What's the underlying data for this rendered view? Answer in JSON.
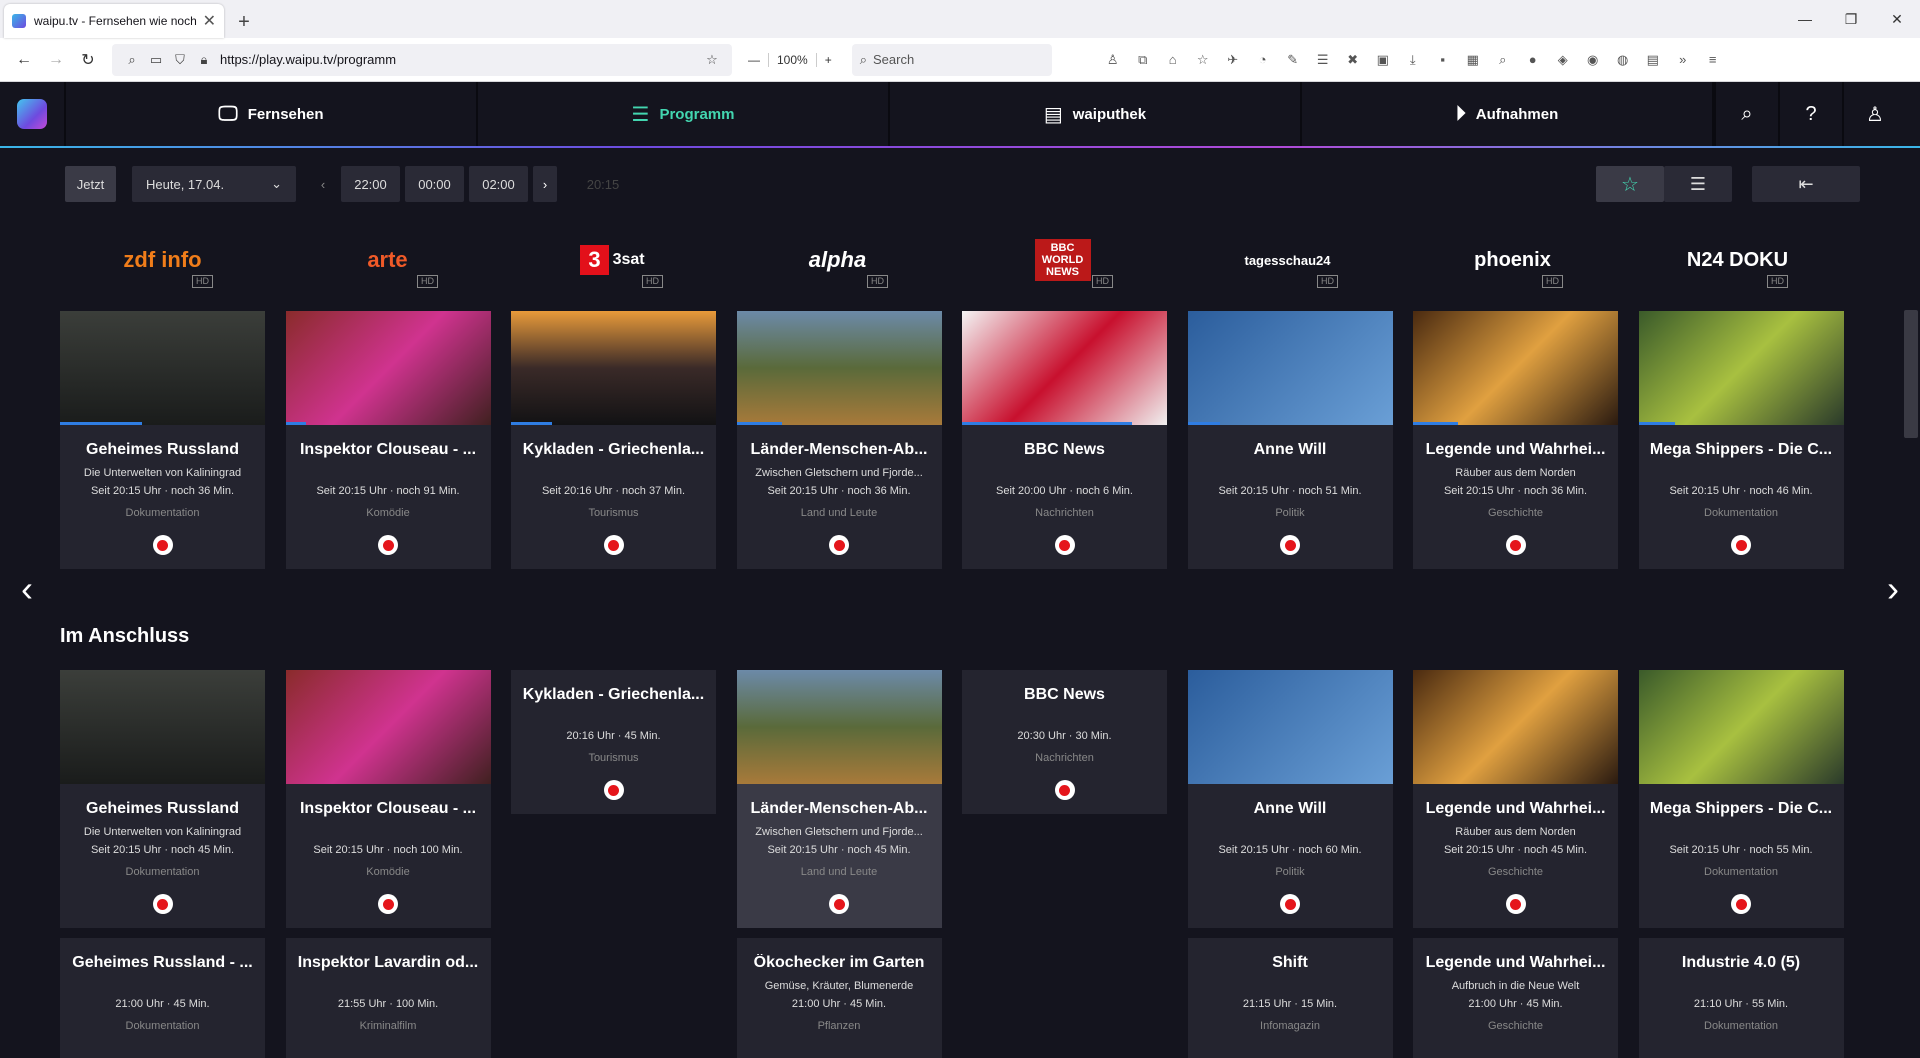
{
  "browser": {
    "tab_title": "waipu.tv - Fernsehen wie noch nie",
    "url": "https://play.waipu.tv/programm",
    "zoom": "100%",
    "search_placeholder": "Search"
  },
  "header": {
    "nav": [
      {
        "label": "Fernsehen",
        "icon": "tv-icon"
      },
      {
        "label": "Programm",
        "icon": "program-guide-icon",
        "active": true
      },
      {
        "label": "waiputhek",
        "icon": "library-icon"
      },
      {
        "label": "Aufnahmen",
        "icon": "play-circle-icon"
      }
    ]
  },
  "filters": {
    "now_label": "Jetzt",
    "date_label": "Heute, 17.04.",
    "times": [
      "22:00",
      "00:00",
      "02:00"
    ],
    "current_time": "20:15"
  },
  "channels": [
    {
      "name": "zdf info",
      "hd": "HD"
    },
    {
      "name": "arte",
      "hd": "HD"
    },
    {
      "name": "3sat",
      "hd": "HD"
    },
    {
      "name": "alpha",
      "hd": "HD"
    },
    {
      "name": "BBC WORLD NEWS",
      "hd": "HD"
    },
    {
      "name": "tagesschau24",
      "hd": "HD"
    },
    {
      "name": "phoenix",
      "hd": "HD"
    },
    {
      "name": "N24 DOKU",
      "hd": "HD"
    }
  ],
  "now_row": [
    {
      "title": "Geheimes Russland",
      "subtitle": "Die Unterwelten von Kaliningrad",
      "time": "Seit 20:15 Uhr · noch 36 Min.",
      "genre": "Dokumentation",
      "progress": 0.4
    },
    {
      "title": "Inspektor Clouseau - ...",
      "subtitle": "",
      "time": "Seit 20:15 Uhr · noch 91 Min.",
      "genre": "Komödie",
      "progress": 0.1
    },
    {
      "title": "Kykladen - Griechenla...",
      "subtitle": "",
      "time": "Seit 20:16 Uhr · noch 37 Min.",
      "genre": "Tourismus",
      "progress": 0.2
    },
    {
      "title": "Länder-Menschen-Ab...",
      "subtitle": "Zwischen Gletschern und Fjorde...",
      "time": "Seit 20:15 Uhr · noch 36 Min.",
      "genre": "Land und Leute",
      "progress": 0.22
    },
    {
      "title": "BBC News",
      "subtitle": "",
      "time": "Seit 20:00 Uhr · noch 6 Min.",
      "genre": "Nachrichten",
      "progress": 0.83
    },
    {
      "title": "Anne Will",
      "subtitle": "",
      "time": "Seit 20:15 Uhr · noch 51 Min.",
      "genre": "Politik",
      "progress": 0.16
    },
    {
      "title": "Legende und Wahrhei...",
      "subtitle": "Räuber aus dem Norden",
      "time": "Seit 20:15 Uhr · noch 36 Min.",
      "genre": "Geschichte",
      "progress": 0.22
    },
    {
      "title": "Mega Shippers - Die C...",
      "subtitle": "",
      "time": "Seit 20:15 Uhr · noch 46 Min.",
      "genre": "Dokumentation",
      "progress": 0.18
    }
  ],
  "next_section_title": "Im Anschluss",
  "next_row": [
    {
      "title": "Geheimes Russland",
      "subtitle": "Die Unterwelten von Kaliningrad",
      "time": "Seit 20:15 Uhr · noch 45 Min.",
      "genre": "Dokumentation",
      "thumb": true
    },
    {
      "title": "Inspektor Clouseau - ...",
      "subtitle": "",
      "time": "Seit 20:15 Uhr · noch 100 Min.",
      "genre": "Komödie",
      "thumb": true
    },
    {
      "title": "Kykladen - Griechenla...",
      "subtitle": "",
      "time": "20:16 Uhr · 45 Min.",
      "genre": "Tourismus",
      "thumb": false
    },
    {
      "title": "Länder-Menschen-Ab...",
      "subtitle": "Zwischen Gletschern und Fjorde...",
      "time": "Seit 20:15 Uhr · noch 45 Min.",
      "genre": "Land und Leute",
      "thumb": true,
      "highlight": true
    },
    {
      "title": "BBC News",
      "subtitle": "",
      "time": "20:30 Uhr · 30 Min.",
      "genre": "Nachrichten",
      "thumb": false
    },
    {
      "title": "Anne Will",
      "subtitle": "",
      "time": "Seit 20:15 Uhr · noch 60 Min.",
      "genre": "Politik",
      "thumb": true
    },
    {
      "title": "Legende und Wahrhei...",
      "subtitle": "Räuber aus dem Norden",
      "time": "Seit 20:15 Uhr · noch 45 Min.",
      "genre": "Geschichte",
      "thumb": true
    },
    {
      "title": "Mega Shippers - Die C...",
      "subtitle": "",
      "time": "Seit 20:15 Uhr · noch 55 Min.",
      "genre": "Dokumentation",
      "thumb": true
    }
  ],
  "later_row": [
    {
      "title": "Geheimes Russland - ...",
      "subtitle": "",
      "time": "21:00 Uhr · 45 Min.",
      "genre": "Dokumentation"
    },
    {
      "title": "Inspektor Lavardin od...",
      "subtitle": "",
      "time": "21:55 Uhr · 100 Min.",
      "genre": "Kriminalfilm"
    },
    null,
    {
      "title": "Ökochecker im Garten",
      "subtitle": "Gemüse, Kräuter, Blumenerde",
      "time": "21:00 Uhr · 45 Min.",
      "genre": "Pflanzen"
    },
    null,
    {
      "title": "Shift",
      "subtitle": "",
      "time": "21:15 Uhr · 15 Min.",
      "genre": "Infomagazin"
    },
    {
      "title": "Legende und Wahrhei...",
      "subtitle": "Aufbruch in die Neue Welt",
      "time": "21:00 Uhr · 45 Min.",
      "genre": "Geschichte"
    },
    {
      "title": "Industrie 4.0 (5)",
      "subtitle": "",
      "time": "21:10 Uhr · 55 Min.",
      "genre": "Dokumentation"
    }
  ],
  "colors": {
    "accent": "#43d6b0",
    "record": "#e5151b",
    "progress": "#2f7de3"
  }
}
